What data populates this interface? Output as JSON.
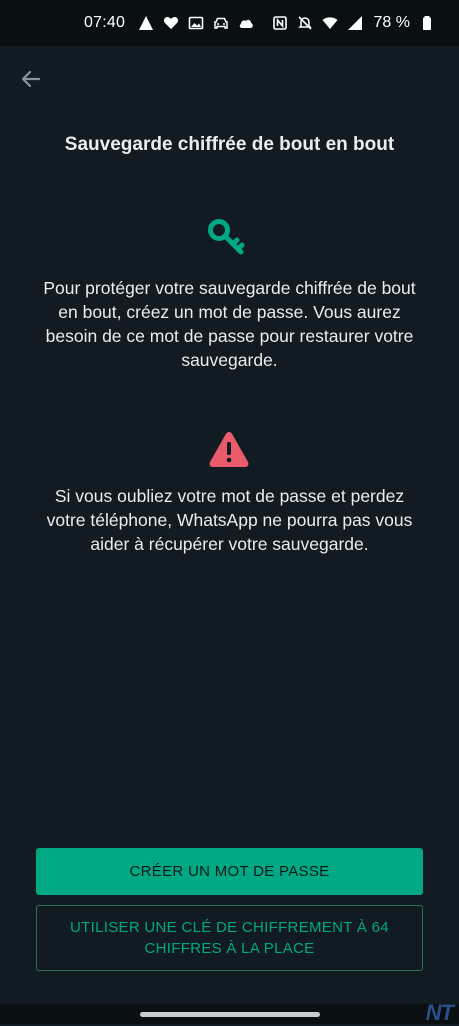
{
  "status_bar": {
    "time": "07:40",
    "battery_text": "78 %",
    "icons_left": [
      "navigation-arrow-icon",
      "heart-icon",
      "image-icon",
      "car-icon",
      "cloud-icon"
    ],
    "icons_right": [
      "nfc-icon",
      "mute-icon",
      "wifi-icon",
      "signal-icon",
      "battery-icon"
    ]
  },
  "screen": {
    "title": "Sauvegarde chiffrée de bout en bout",
    "key_icon": "key-icon",
    "paragraph_1": "Pour protéger votre sauvegarde chiffrée de bout en bout, créez un mot de passe. Vous aurez besoin de ce mot de passe pour restaurer votre sauvegarde.",
    "warning_icon": "warning-icon",
    "paragraph_2": "Si vous oubliez votre mot de passe et perdez votre téléphone, WhatsApp ne pourra pas vous aider à récupérer votre sauvegarde."
  },
  "buttons": {
    "primary_label": "CRÉER UN MOT DE PASSE",
    "secondary_label": "UTILISER UNE CLÉ DE CHIFFREMENT À 64 CHIFFRES À LA PLACE"
  },
  "watermark": "NT",
  "colors": {
    "background": "#111b21",
    "accent": "#00a884",
    "warning": "#ea5b6b",
    "text": "#e9edef"
  }
}
